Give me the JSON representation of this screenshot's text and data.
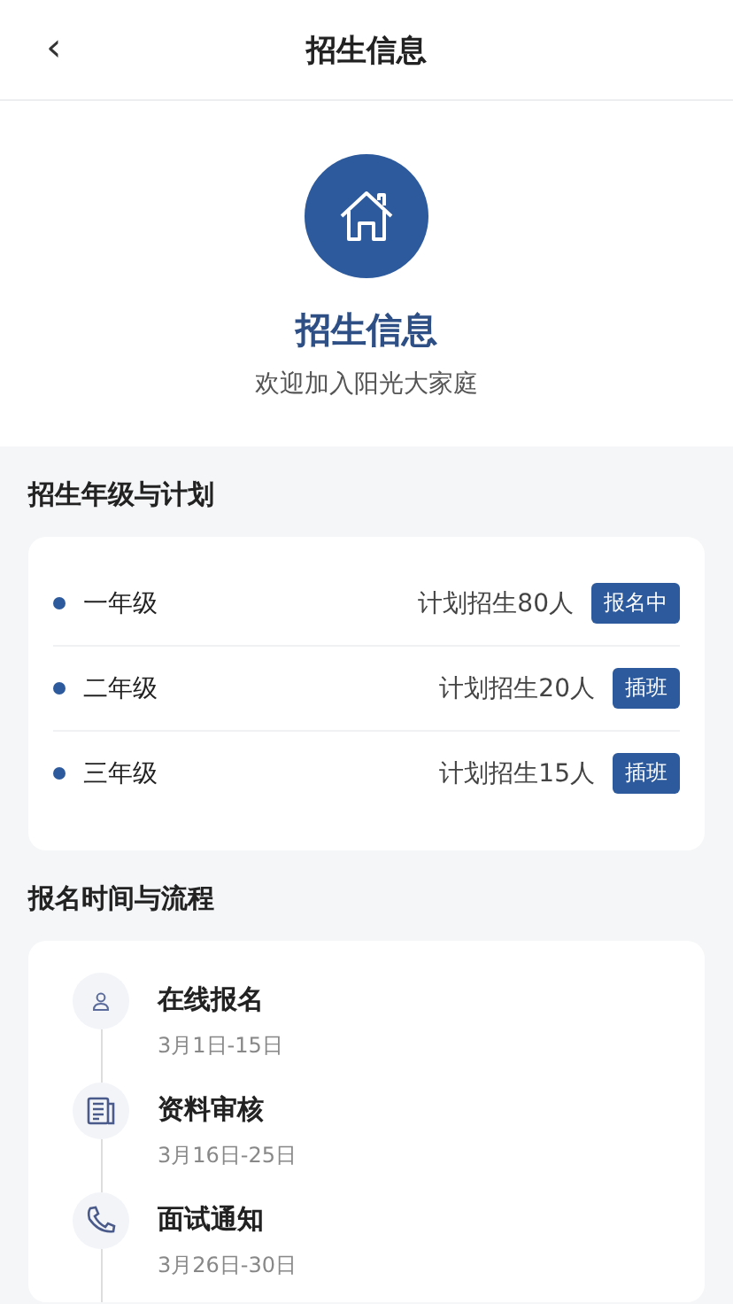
{
  "header": {
    "back": "‹",
    "title": "招生信息"
  },
  "hero": {
    "title": "招生信息",
    "subtitle": "欢迎加入阳光大家庭"
  },
  "plan": {
    "title": "招生年级与计划",
    "grades": [
      {
        "name": "一年级",
        "plan": "计划招生80人",
        "tag": "报名中"
      },
      {
        "name": "二年级",
        "plan": "计划招生20人",
        "tag": "插班"
      },
      {
        "name": "三年级",
        "plan": "计划招生15人",
        "tag": "插班"
      }
    ]
  },
  "process": {
    "title": "报名时间与流程",
    "steps": [
      {
        "kind": "person",
        "title": "在线报名",
        "date": "3月1日-15日"
      },
      {
        "kind": "document",
        "title": "资料审核",
        "date": "3月16日-25日"
      },
      {
        "kind": "phone",
        "title": "面试通知",
        "date": "3月26日-30日"
      }
    ]
  }
}
